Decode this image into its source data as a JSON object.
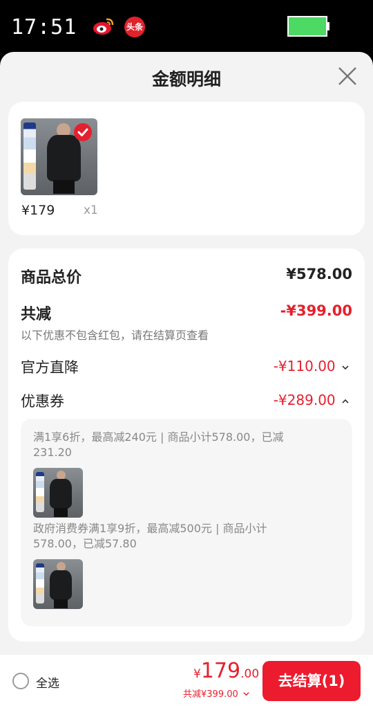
{
  "status_bar": {
    "time": "17:51",
    "app_badge_text": "头条",
    "battery_color": "#4cd964"
  },
  "sheet": {
    "title": "金额明细"
  },
  "products": [
    {
      "price": "¥179",
      "qty": "x1",
      "checked": true
    }
  ],
  "detail": {
    "goods_total_label": "商品总价",
    "goods_total_value": "¥578.00",
    "total_discount_label": "共减",
    "total_discount_value": "-¥399.00",
    "discount_note": "以下优惠不包含红包，请在结算页查看",
    "official_drop_label": "官方直降",
    "official_drop_value": "-¥110.00",
    "coupon_label": "优惠券",
    "coupon_value": "-¥289.00",
    "coupons": [
      {
        "line1": "满1享6折，最高减240元 | 商品小计578.00，已减",
        "line2": "231.20"
      },
      {
        "line1": "政府消费券满1享9折，最高减500元 | 商品小计",
        "line2": "578.00，已减57.80"
      }
    ]
  },
  "bottom_bar": {
    "select_all_label": "全选",
    "total_currency": "¥",
    "total_integer": "179",
    "total_decimal": ".00",
    "total_discount_text": "共减¥399.00",
    "checkout_label": "去结算(1)"
  },
  "colors": {
    "accent_red": "#e5202e",
    "checkout_button": "#ec1b2e"
  }
}
